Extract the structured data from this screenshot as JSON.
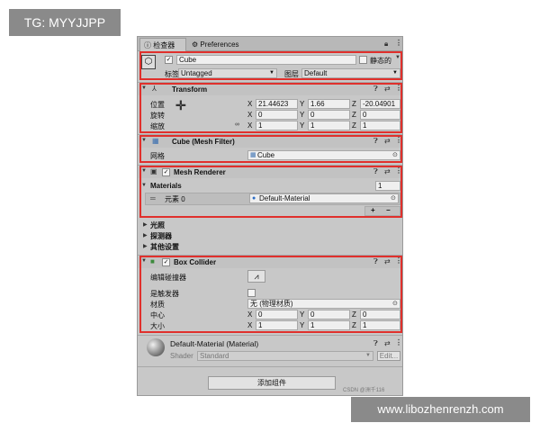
{
  "overlay": {
    "tg": "TG: MYYJJPP",
    "watermark": "www.libozhenrenzh.com",
    "csdn": "CSDN @洲千116"
  },
  "tabs": {
    "inspector": "检查器",
    "preferences": "Preferences"
  },
  "object": {
    "name": "Cube",
    "static_label": "静态的",
    "tag_label": "标签",
    "tag_value": "Untagged",
    "layer_label": "图层",
    "layer_value": "Default"
  },
  "transform": {
    "title": "Transform",
    "position_label": "位置",
    "rotation_label": "旋转",
    "scale_label": "缩放",
    "x": "X",
    "y": "Y",
    "z": "Z",
    "position": [
      "21.44623",
      "1.66",
      "-20.04901"
    ],
    "rotation": [
      "0",
      "0",
      "0"
    ],
    "scale": [
      "1",
      "1",
      "1"
    ]
  },
  "mesh_filter": {
    "title": "Cube (Mesh Filter)",
    "mesh_label": "网格",
    "mesh_value": "Cube"
  },
  "mesh_renderer": {
    "title": "Mesh Renderer",
    "materials_label": "Materials",
    "materials_count": "1",
    "element_label": "元素 0",
    "element_value": "Default-Material",
    "add": "+",
    "remove": "−"
  },
  "sections": {
    "lighting": "光照",
    "probes": "探测器",
    "other": "其他设置"
  },
  "box_collider": {
    "title": "Box Collider",
    "edit_label": "编辑碰撞器",
    "trigger_label": "是触发器",
    "material_label": "材质",
    "material_value": "无 (物理材质)",
    "center_label": "中心",
    "size_label": "大小",
    "center": [
      "0",
      "0",
      "0"
    ],
    "size": [
      "1",
      "1",
      "1"
    ]
  },
  "material_preview": {
    "title": "Default-Material (Material)",
    "shader_label": "Shader",
    "shader_value": "Standard",
    "edit": "Edit..."
  },
  "add_component": "添加组件",
  "colors": {
    "highlight": "#e0302c",
    "panel": "#c8c8c8"
  }
}
